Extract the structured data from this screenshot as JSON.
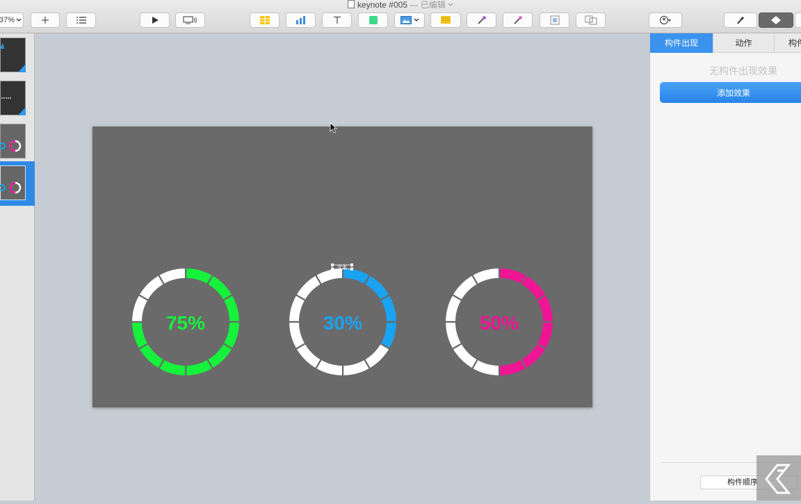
{
  "window": {
    "title": "keynote #005",
    "title_separator": "—",
    "status": "已编辑",
    "chevron": "chevron-down-icon"
  },
  "toolbar": {
    "zoom": "37%",
    "buttons": [
      {
        "name": "add-slide",
        "icon": "plus-icon"
      },
      {
        "name": "view",
        "icon": "list-icon"
      },
      {
        "name": "play",
        "icon": "play-icon"
      },
      {
        "name": "keynote-live",
        "icon": "display-icon"
      },
      {
        "name": "table",
        "icon": "table-icon"
      },
      {
        "name": "chart",
        "icon": "bar-chart-icon"
      },
      {
        "name": "text",
        "icon": "text-icon"
      },
      {
        "name": "shape",
        "icon": "shape-icon"
      },
      {
        "name": "media",
        "icon": "image-icon"
      },
      {
        "name": "comment",
        "icon": "comment-icon"
      },
      {
        "name": "magic-move-1",
        "icon": "magic-wand-icon"
      },
      {
        "name": "magic-move-2",
        "icon": "magic-wand-icon"
      },
      {
        "name": "front",
        "icon": "front-icon"
      },
      {
        "name": "back",
        "icon": "back-icon"
      },
      {
        "name": "collaborate",
        "icon": "collaborate-icon"
      },
      {
        "name": "format",
        "icon": "paintbrush-icon"
      },
      {
        "name": "animate",
        "icon": "diamond-icon"
      }
    ]
  },
  "slide": {
    "background": "#6a6a6a",
    "selection_label": "文本",
    "rings": [
      {
        "label": "75%",
        "value": 0.75,
        "color": "#16f23c"
      },
      {
        "label": "30%",
        "value": 0.3,
        "color": "#1aa3f3"
      },
      {
        "label": "50%",
        "value": 0.5,
        "color": "#f01595"
      }
    ],
    "ring_track_color": "#ffffff"
  },
  "inspector": {
    "tabs": [
      {
        "label": "构件出现",
        "active": true
      },
      {
        "label": "动作",
        "active": false
      },
      {
        "label": "构件",
        "active": false
      }
    ],
    "empty_message": "无构件出现效果",
    "add_button": "添加效果",
    "build_order_button": "构件顺序"
  },
  "colors": {
    "accent": "#2f8ae6",
    "canvas": "#c6ccd3"
  }
}
